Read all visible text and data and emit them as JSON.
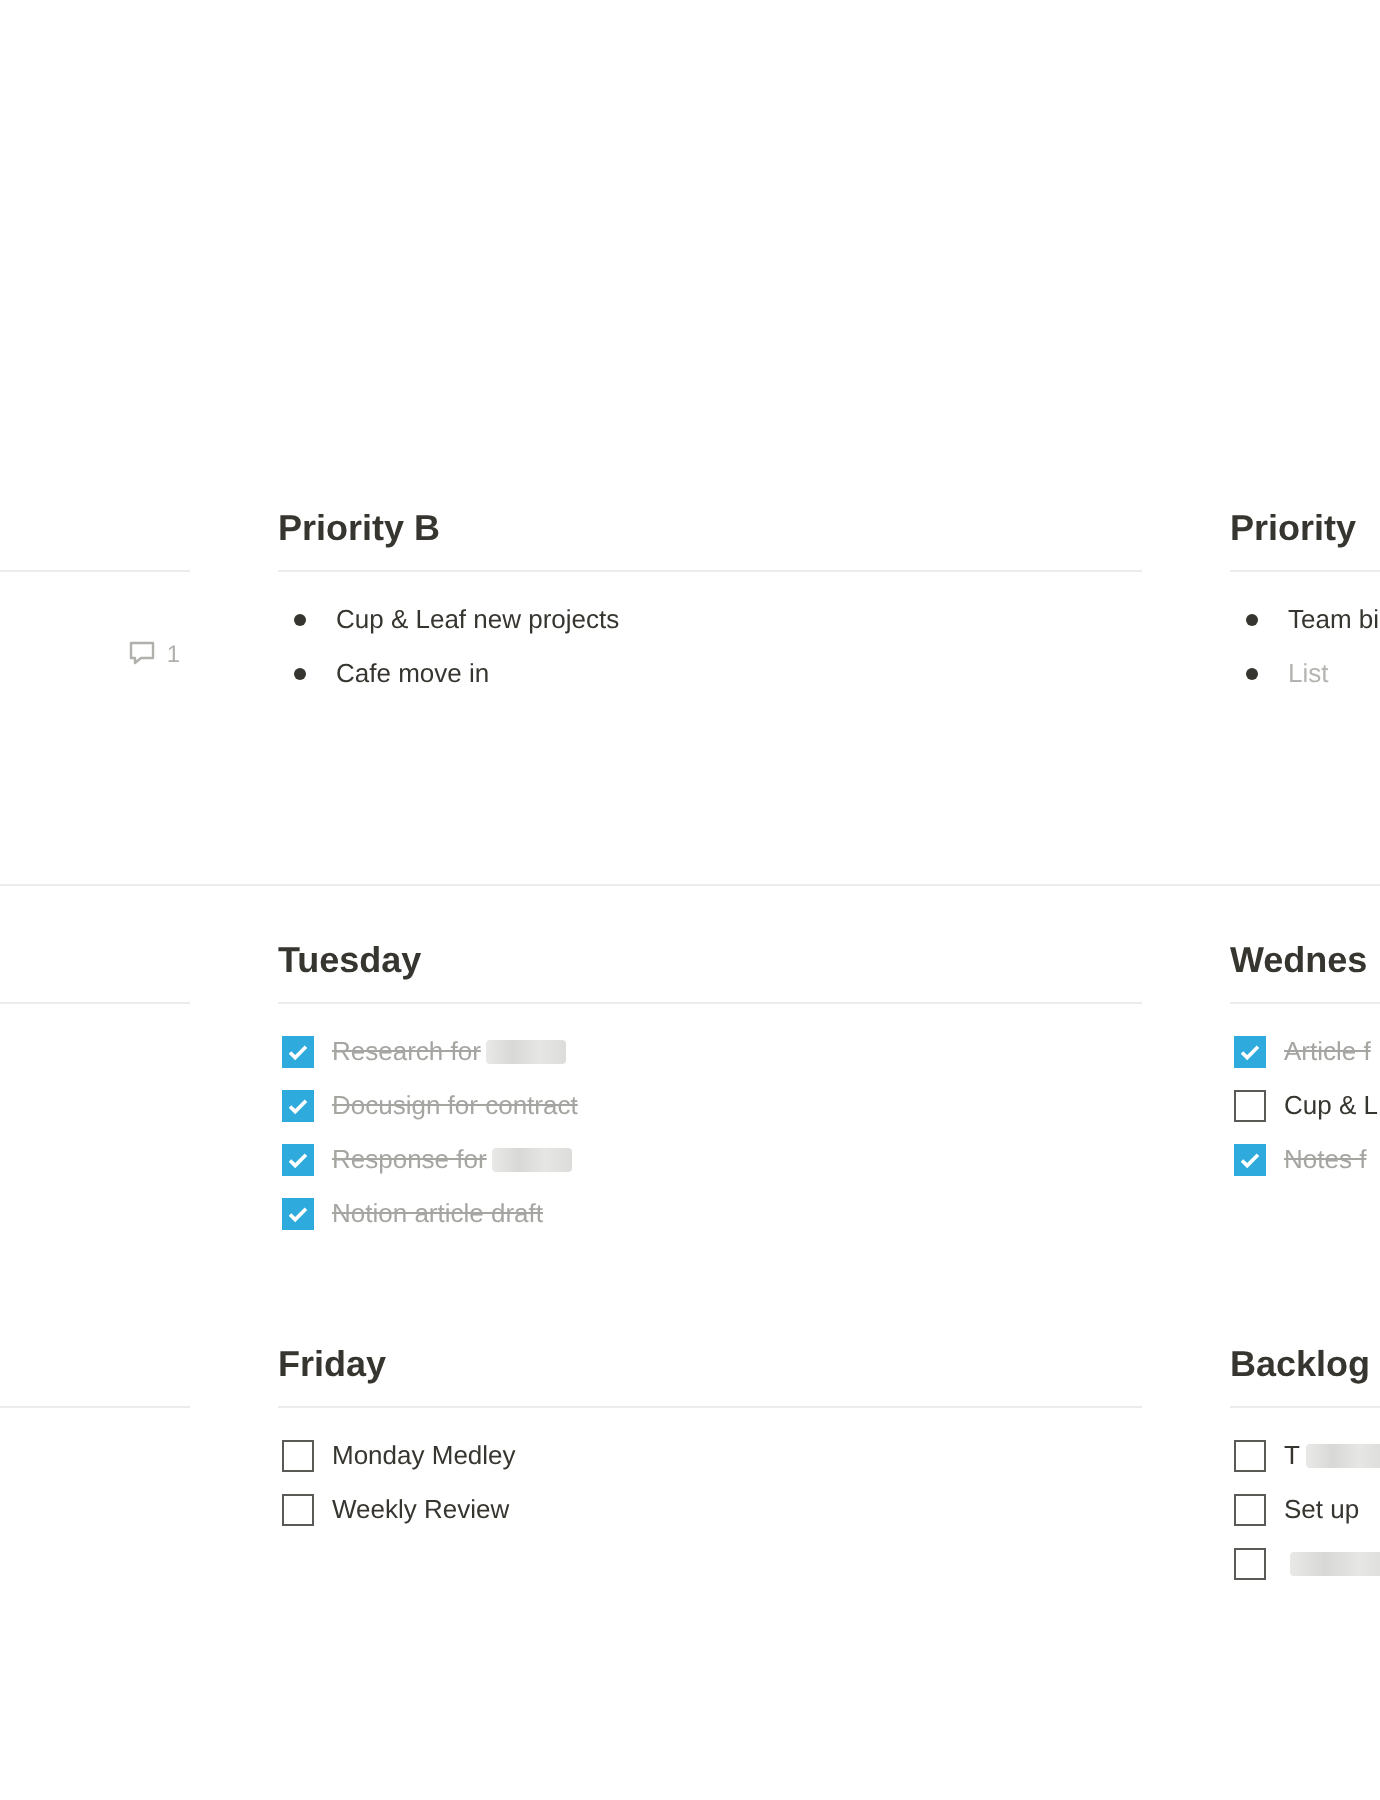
{
  "rows": [
    {
      "sections": [
        {
          "kind": "comments",
          "comment_count": "1"
        },
        {
          "kind": "bullets",
          "title": "Priority B",
          "items": [
            {
              "text": "Cup & Leaf new projects",
              "muted": false
            },
            {
              "text": "Cafe move in",
              "muted": false
            }
          ]
        },
        {
          "kind": "bullets",
          "title": "Priority",
          "items": [
            {
              "text": "Team bi",
              "muted": false
            },
            {
              "text": "List",
              "muted": true
            }
          ]
        }
      ]
    },
    {
      "sections": [
        {
          "kind": "blank"
        },
        {
          "kind": "todos",
          "title": "Tuesday",
          "items": [
            {
              "text": "Research for",
              "checked": true,
              "redacted": true
            },
            {
              "text": "Docusign for contract",
              "checked": true,
              "redacted": false
            },
            {
              "text": "Response for",
              "checked": true,
              "redacted": true
            },
            {
              "text": "Notion article draft",
              "checked": true,
              "redacted": false
            }
          ]
        },
        {
          "kind": "todos",
          "title": "Wednes",
          "items": [
            {
              "text": "Article f",
              "checked": true,
              "redacted": false
            },
            {
              "text": "Cup & L",
              "checked": false,
              "redacted": false
            },
            {
              "text": "Notes f",
              "checked": true,
              "redacted": false
            }
          ]
        }
      ]
    },
    {
      "sections": [
        {
          "kind": "blank"
        },
        {
          "kind": "todos",
          "title": "Friday",
          "items": [
            {
              "text": "Monday Medley",
              "checked": false,
              "redacted": false
            },
            {
              "text": "Weekly Review",
              "checked": false,
              "redacted": false
            }
          ]
        },
        {
          "kind": "todos",
          "title": "Backlog",
          "items": [
            {
              "text": "T",
              "checked": false,
              "redacted": true
            },
            {
              "text": "Set up",
              "checked": false,
              "redacted": false
            },
            {
              "checked": false,
              "redacted": true
            }
          ]
        }
      ]
    }
  ]
}
